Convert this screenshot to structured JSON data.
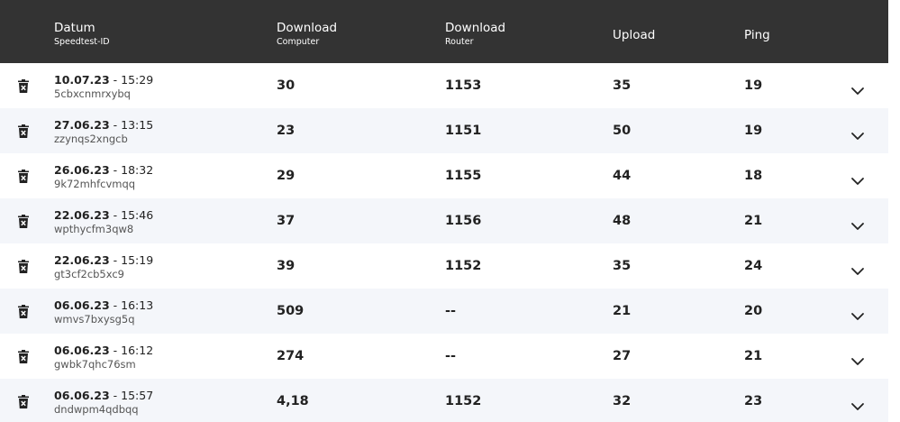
{
  "header": {
    "date_label": "Datum",
    "date_sub": "Speedtest-ID",
    "dl_computer_label": "Download",
    "dl_computer_sub": "Computer",
    "dl_router_label": "Download",
    "dl_router_sub": "Router",
    "upload_label": "Upload",
    "ping_label": "Ping"
  },
  "rows": [
    {
      "date": "10.07.23",
      "time": " - 15:29",
      "id": "5cbxcnmrxybq",
      "dl_computer": "30",
      "dl_router": "1153",
      "upload": "35",
      "ping": "19"
    },
    {
      "date": "27.06.23",
      "time": " - 13:15",
      "id": "zzynqs2xngcb",
      "dl_computer": "23",
      "dl_router": "1151",
      "upload": "50",
      "ping": "19"
    },
    {
      "date": "26.06.23",
      "time": " - 18:32",
      "id": "9k72mhfcvmqq",
      "dl_computer": "29",
      "dl_router": "1155",
      "upload": "44",
      "ping": "18"
    },
    {
      "date": "22.06.23",
      "time": " - 15:46",
      "id": "wpthycfm3qw8",
      "dl_computer": "37",
      "dl_router": "1156",
      "upload": "48",
      "ping": "21"
    },
    {
      "date": "22.06.23",
      "time": " - 15:19",
      "id": "gt3cf2cb5xc9",
      "dl_computer": "39",
      "dl_router": "1152",
      "upload": "35",
      "ping": "24"
    },
    {
      "date": "06.06.23",
      "time": " - 16:13",
      "id": "wmvs7bxysg5q",
      "dl_computer": "509",
      "dl_router": "--",
      "upload": "21",
      "ping": "20"
    },
    {
      "date": "06.06.23",
      "time": " - 16:12",
      "id": "gwbk7qhc76sm",
      "dl_computer": "274",
      "dl_router": "--",
      "upload": "27",
      "ping": "21"
    },
    {
      "date": "06.06.23",
      "time": " - 15:57",
      "id": "dndwpm4qdbqq",
      "dl_computer": "4,18",
      "dl_router": "1152",
      "upload": "32",
      "ping": "23"
    }
  ],
  "icons": {
    "delete": "trash-icon",
    "expand": "chevron-down-icon"
  },
  "colors": {
    "header_bg": "#333333",
    "row_alt_bg": "#f4f6fa"
  }
}
